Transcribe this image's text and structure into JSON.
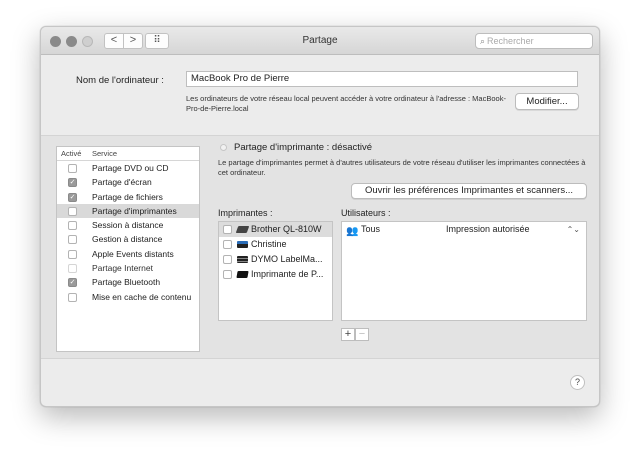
{
  "window": {
    "title": "Partage",
    "search_placeholder": "Rechercher",
    "nav_back": "<",
    "nav_forward": ">",
    "grid_glyph": "⠿"
  },
  "computer": {
    "name_label": "Nom de l'ordinateur :",
    "name_value": "MacBook Pro de Pierre",
    "description": "Les ordinateurs de votre réseau local peuvent accéder à votre ordinateur à l'adresse : MacBook-Pro-de-Pierre.local",
    "modify_button": "Modifier..."
  },
  "services": {
    "header_active": "Activé",
    "header_service": "Service",
    "items": [
      {
        "label": "Partage DVD ou CD",
        "checked": false,
        "selected": false,
        "disabled": false
      },
      {
        "label": "Partage d'écran",
        "checked": true,
        "selected": false,
        "disabled": false
      },
      {
        "label": "Partage de fichiers",
        "checked": true,
        "selected": false,
        "disabled": false
      },
      {
        "label": "Partage d'imprimantes",
        "checked": false,
        "selected": true,
        "disabled": false
      },
      {
        "label": "Session à distance",
        "checked": false,
        "selected": false,
        "disabled": false
      },
      {
        "label": "Gestion à distance",
        "checked": false,
        "selected": false,
        "disabled": false
      },
      {
        "label": "Apple Events distants",
        "checked": false,
        "selected": false,
        "disabled": false
      },
      {
        "label": "Partage Internet",
        "checked": false,
        "selected": false,
        "disabled": true
      },
      {
        "label": "Partage Bluetooth",
        "checked": true,
        "selected": false,
        "disabled": false
      },
      {
        "label": "Mise en cache de contenu",
        "checked": false,
        "selected": false,
        "disabled": false
      }
    ]
  },
  "printer_sharing": {
    "status": "Partage d'imprimante : désactivé",
    "description": "Le partage d'imprimantes permet à d'autres utilisateurs de votre réseau d'utiliser les imprimantes connectées à cet ordinateur.",
    "open_prefs_button": "Ouvrir les préférences Imprimantes et scanners...",
    "printers_label": "Imprimantes :",
    "users_label": "Utilisateurs :",
    "printers": [
      {
        "name": "Brother QL-810W",
        "checked": false,
        "selected": true,
        "icon": "label-printer-icon"
      },
      {
        "name": "Christine",
        "checked": false,
        "selected": false,
        "icon": "laser-printer-icon"
      },
      {
        "name": "DYMO LabelMa...",
        "checked": false,
        "selected": false,
        "icon": "label-maker-icon"
      },
      {
        "name": "Imprimante de P...",
        "checked": false,
        "selected": false,
        "icon": "printer-icon"
      }
    ],
    "users": [
      {
        "name": "Tous",
        "permission": "Impression autorisée",
        "icon": "group-icon"
      }
    ],
    "add_button": "+",
    "remove_button": "−"
  },
  "help_button": "?"
}
